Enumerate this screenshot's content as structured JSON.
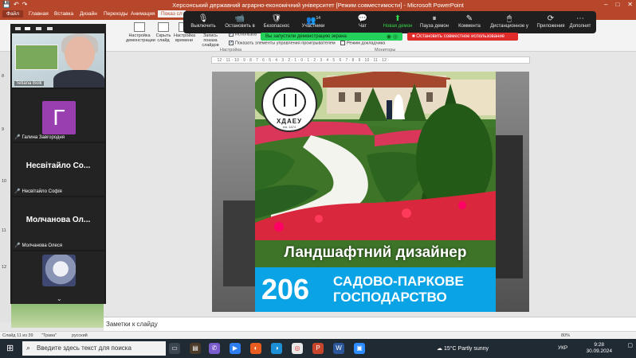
{
  "ppt": {
    "title": "Херсонський державний аграрно-економічний університет [Режим совместимости] - Microsoft PowerPoint",
    "window_controls": [
      "–",
      "□",
      "✕"
    ],
    "tabs": [
      "Файл",
      "Главная",
      "Вставка",
      "Дизайн",
      "Переходы",
      "Анимация",
      "Показ сл"
    ],
    "ribbon": {
      "group1": "Настройка демонстрации",
      "group2": "Скрыть слайд",
      "group3": "Настройка времени",
      "group4": "Запись показа слайдов",
      "check1": "Использов",
      "check2": "Показать элементы управления проигрывателем",
      "check3": "Режим докладчика",
      "label_setup": "Настройка",
      "label_monitors": "Мониторы"
    },
    "ruler": "· 12 · 11 · 10 · 9 · 8 · 7 · 6 · 5 · 4 · 3 · 2 · 1 · 0 · 1 · 2 · 3 · 4 · 5 · 6 · 7 · 8 · 9 · 10 · 11 · 12 ·",
    "thumb_numbers": [
      "8",
      "9",
      "10",
      "11",
      "12"
    ],
    "notes_placeholder": "Заметки к слайду",
    "status": {
      "slide": "Слайд 11 из 39",
      "theme": "\"Трава\"",
      "language": "русский",
      "zoom": "80%"
    }
  },
  "slide": {
    "logo_text": "ХДАЕУ",
    "logo_sub": "est. 1874",
    "title": "Ландшафтний дизайнер",
    "code": "206",
    "subtitle_line1": "САДОВО-ПАРКОВЕ",
    "subtitle_line2": "ГОСПОДАРСТВО",
    "colors": {
      "banner": "#0aa3e5",
      "title_text": "#ffffff"
    }
  },
  "zoom": {
    "buttons": [
      {
        "icon": "🎙",
        "label": "Выключить"
      },
      {
        "icon": "📹",
        "label": "Остановить в"
      },
      {
        "icon": "🛡",
        "label": "Безопаснос"
      },
      {
        "icon": "👥",
        "label": "Участники",
        "count": "14"
      },
      {
        "icon": "💬",
        "label": "Чат"
      },
      {
        "icon": "⬆",
        "label": "Новая демон"
      },
      {
        "icon": "⏸",
        "label": "Пауза демон"
      },
      {
        "icon": "✎",
        "label": "Коммента"
      },
      {
        "icon": "🖱",
        "label": "Дистанционное у"
      },
      {
        "icon": "⟳",
        "label": "Приложения"
      },
      {
        "icon": "⋯",
        "label": "Дополнит"
      }
    ],
    "share_notice": "Вы запустили демонстрацию экрана",
    "stop_share": "Остановить совместное использование",
    "participants": [
      {
        "name": "Tetiana Bolk"
      },
      {
        "initial": "Г",
        "name": "Галина Завгородня"
      },
      {
        "display": "Несвітайло  Со...",
        "name": "Несвітайло Софія"
      },
      {
        "display": "Молчанова  Ол...",
        "name": "Молчанова Олеся"
      }
    ],
    "colors": {
      "bar": "#1f1f1f",
      "notice": "#23d05a",
      "stop": "#e02b2b",
      "avatar": "#9a3fb0"
    }
  },
  "taskbar": {
    "search_placeholder": "Введите здесь текст для поиска",
    "weather": "15°C  Partly sunny",
    "lang": "УКР",
    "time": "9:28",
    "date": "30.09.2024"
  }
}
